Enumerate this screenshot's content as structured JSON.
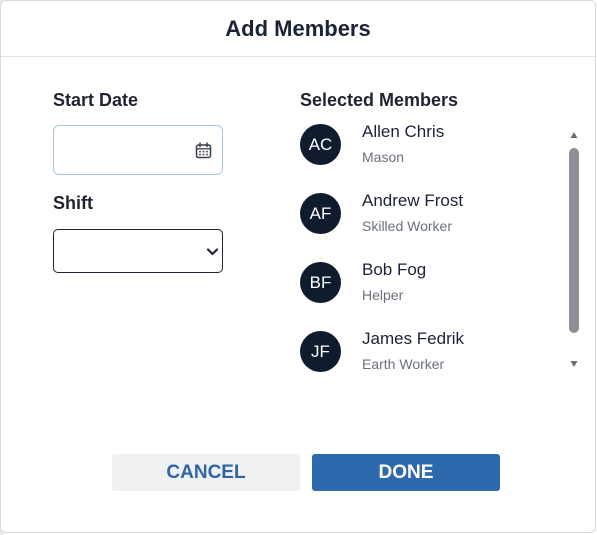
{
  "dialog": {
    "title": "Add Members",
    "start_date": {
      "label": "Start Date",
      "value": "",
      "icon": "calendar-icon"
    },
    "shift": {
      "label": "Shift",
      "value": "",
      "icon": "chevron-down-icon"
    },
    "members_heading": "Selected Members",
    "members": [
      {
        "initials": "AC",
        "name": "Allen Chris",
        "role": "Mason"
      },
      {
        "initials": "AF",
        "name": "Andrew Frost",
        "role": "Skilled Worker"
      },
      {
        "initials": "BF",
        "name": "Bob Fog",
        "role": "Helper"
      },
      {
        "initials": "JF",
        "name": "James Fedrik",
        "role": "Earth Worker"
      }
    ],
    "cancel_label": "CANCEL",
    "done_label": "DONE"
  },
  "colors": {
    "title_text": "#1b2436",
    "avatar_bg": "#101b2e",
    "primary": "#2f69ad",
    "cancel_text": "#2f64a8",
    "cancel_bg": "#f0f1f3",
    "date_border": "#a9c7d6",
    "scroll_thumb": "#8c8f93"
  }
}
